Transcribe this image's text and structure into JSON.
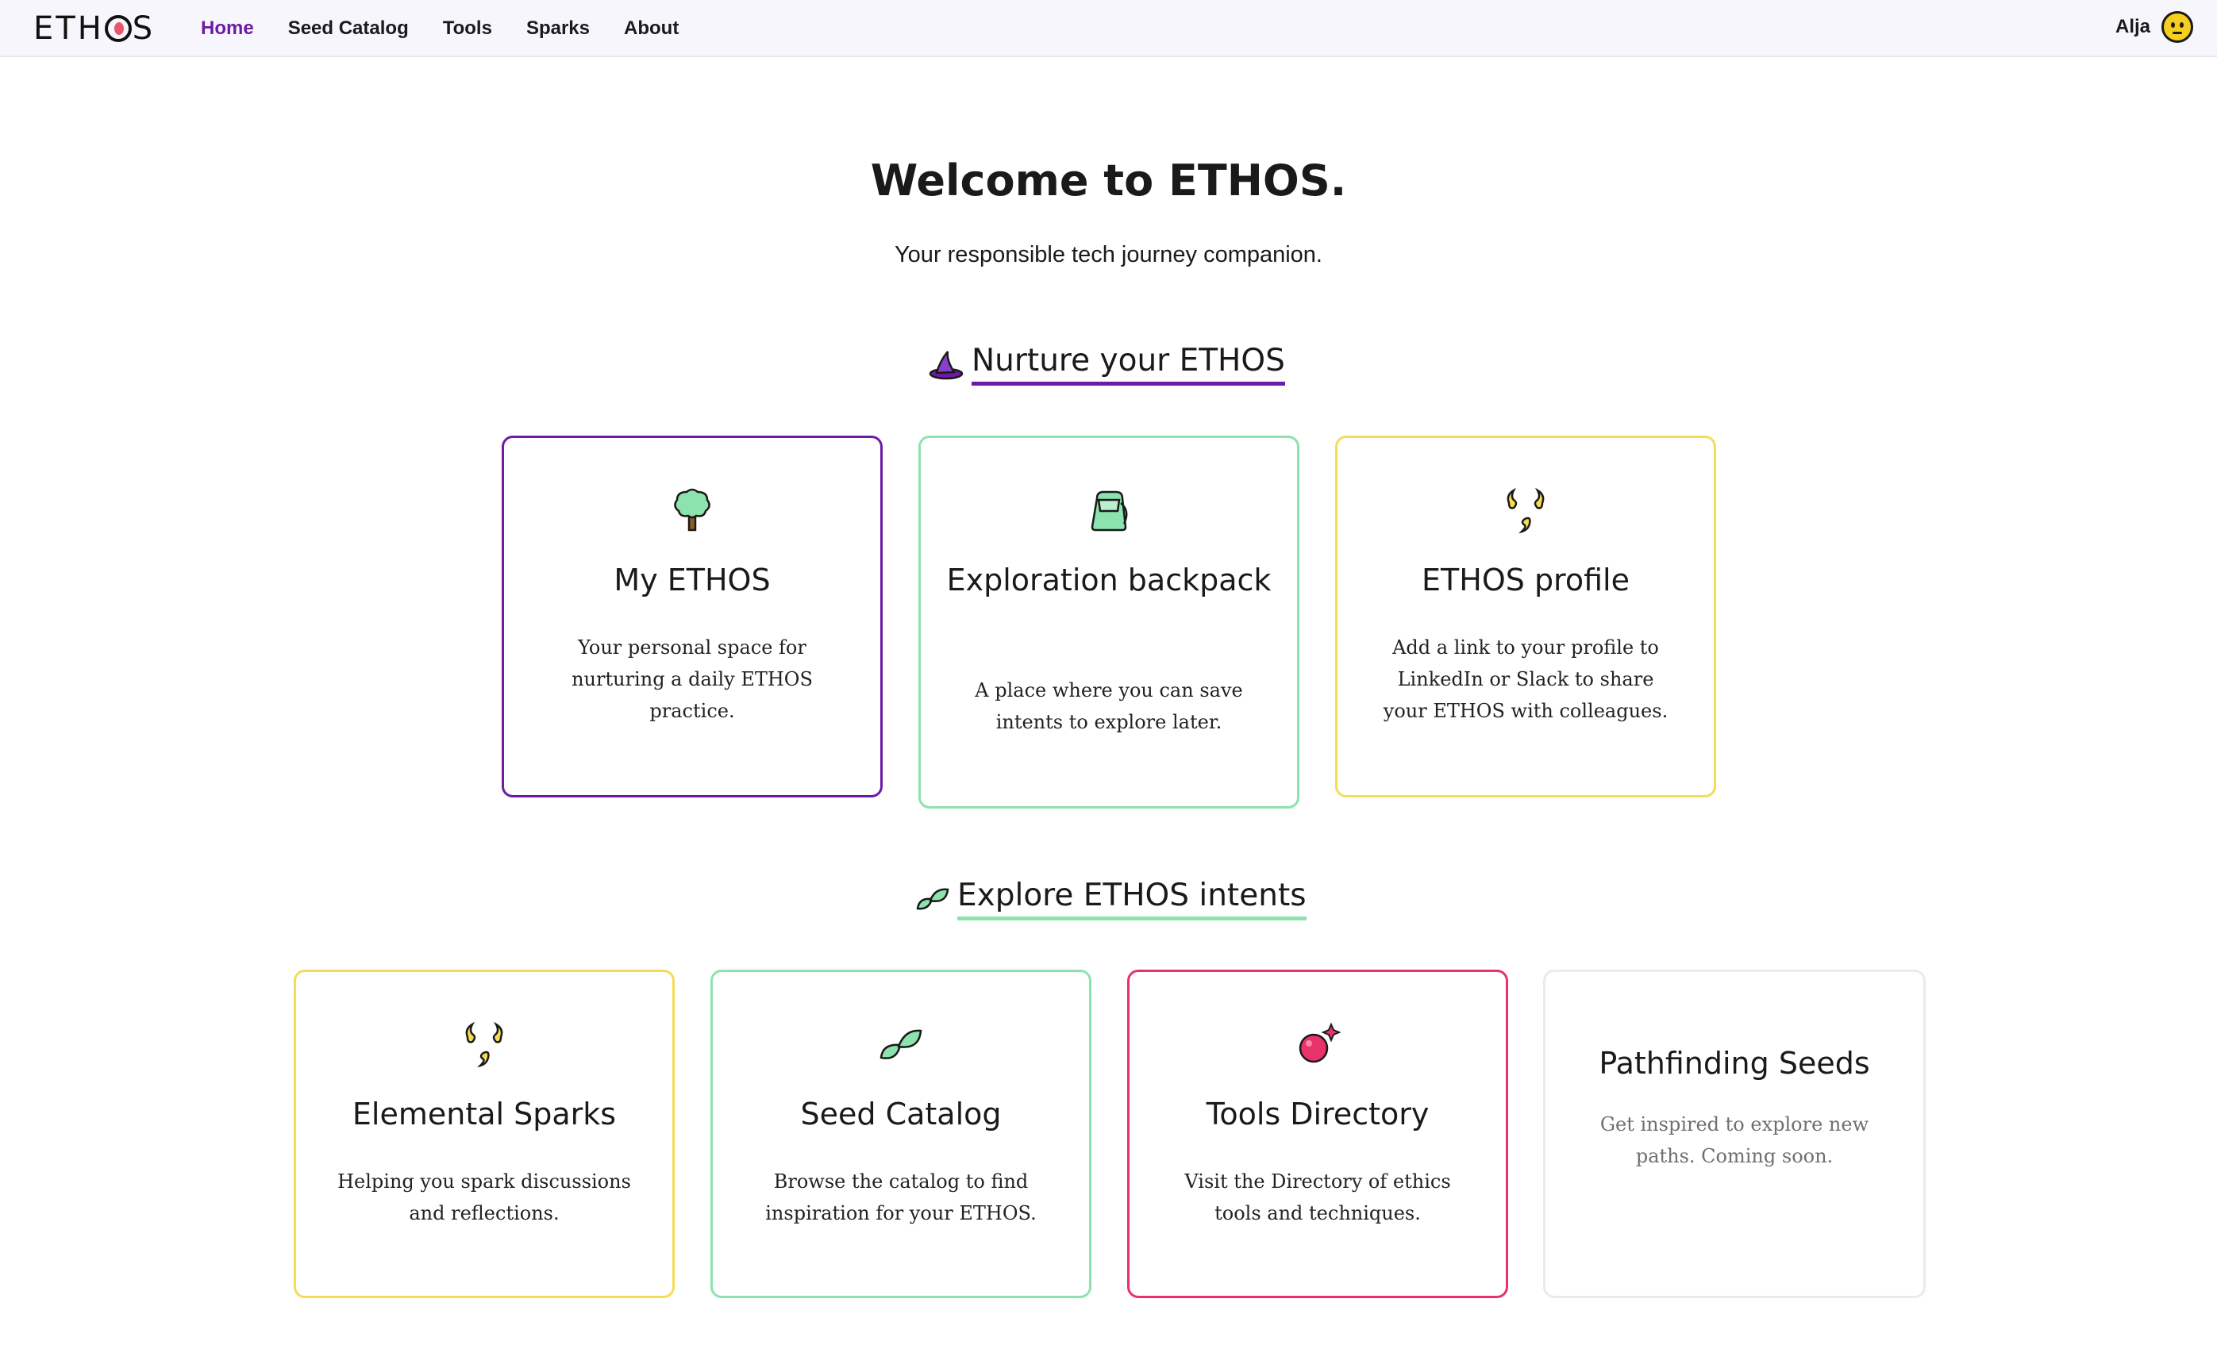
{
  "header": {
    "logo": "ETHOS",
    "nav": [
      {
        "label": "Home",
        "active": true
      },
      {
        "label": "Seed Catalog",
        "active": false
      },
      {
        "label": "Tools",
        "active": false
      },
      {
        "label": "Sparks",
        "active": false
      },
      {
        "label": "About",
        "active": false
      }
    ],
    "user": {
      "name": "Alja",
      "avatar_icon": "smiley-face-icon"
    }
  },
  "hero": {
    "title": "Welcome to ETHOS.",
    "subtitle": "Your responsible tech journey companion."
  },
  "sections": [
    {
      "heading": "Nurture your ETHOS",
      "icon": "witch-hat-icon",
      "underline_color": "#6d1ba5",
      "cards": [
        {
          "title": "My ETHOS",
          "desc": "Your personal space for nurturing a daily ETHOS practice.",
          "icon": "tree-icon",
          "border": "#6d1ba5"
        },
        {
          "title": "Exploration backpack",
          "desc": "A place where you can save intents to explore later.",
          "icon": "backpack-icon",
          "border": "#8de3ad"
        },
        {
          "title": "ETHOS profile",
          "desc": "Add a link to your profile to LinkedIn or Slack to share your ETHOS with colleagues.",
          "icon": "sparks-icon",
          "border": "#f6dc55"
        }
      ]
    },
    {
      "heading": "Explore ETHOS intents",
      "icon": "leaves-icon",
      "underline_color": "#8de3ad",
      "cards": [
        {
          "title": "Elemental Sparks",
          "desc": "Helping you spark discussions and reflections.",
          "icon": "sparks-icon",
          "border": "#f6dc55"
        },
        {
          "title": "Seed Catalog",
          "desc": "Browse the catalog to find inspiration for your ETHOS.",
          "icon": "leaves-icon",
          "border": "#8de3ad"
        },
        {
          "title": "Tools Directory",
          "desc": "Visit the Directory of ethics tools and techniques.",
          "icon": "orb-icon",
          "border": "#e8326a"
        },
        {
          "title": "Pathfinding Seeds",
          "desc": "Get inspired to explore new paths. Coming soon.",
          "icon": "",
          "border": "#ebe9f1"
        }
      ]
    }
  ]
}
